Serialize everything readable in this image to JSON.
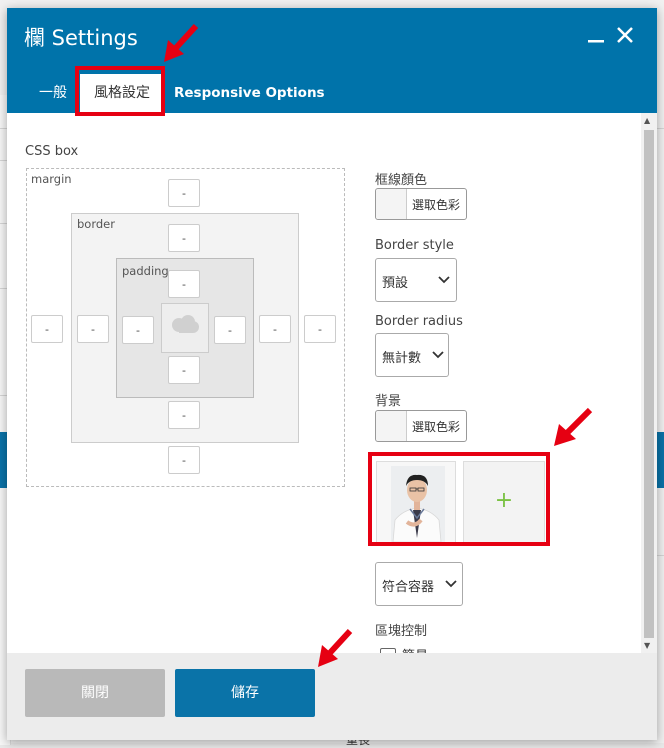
{
  "window": {
    "title": "欄 Settings",
    "minimize_icon": "minimize-icon",
    "close_icon": "close-icon"
  },
  "tabs": [
    {
      "label": "一般"
    },
    {
      "label": "風格設定",
      "active": true
    },
    {
      "label": "Responsive Options"
    }
  ],
  "css_box": {
    "title": "CSS box",
    "margin_label": "margin",
    "border_label": "border",
    "padding_label": "padding",
    "margin": {
      "top": "-",
      "right": "-",
      "bottom": "-",
      "left": "-"
    },
    "border": {
      "top": "-",
      "right": "-",
      "bottom": "-",
      "left": "-"
    },
    "padding": {
      "top": "-",
      "right": "-",
      "bottom": "-",
      "left": "-"
    }
  },
  "right_panel": {
    "border_color_label": "框線顏色",
    "border_color_button": "選取色彩",
    "border_style_label": "Border style",
    "border_style_value": "預設",
    "border_radius_label": "Border radius",
    "border_radius_value": "無計數",
    "background_label": "背景",
    "background_color_button": "選取色彩",
    "add_image_symbol": "+",
    "background_fit_value": "符合容器",
    "block_control_label": "區塊控制",
    "simple_checkbox_label": "簡易"
  },
  "footer": {
    "close_label": "關閉",
    "save_label": "儲存"
  },
  "background_page": {
    "bottom_text": "重長"
  },
  "colors": {
    "header_bg": "#0073aa",
    "save_button": "#0a73a8",
    "close_button": "#b9b9b9",
    "annotation_red": "#e60012",
    "add_plus": "#7ac143"
  }
}
